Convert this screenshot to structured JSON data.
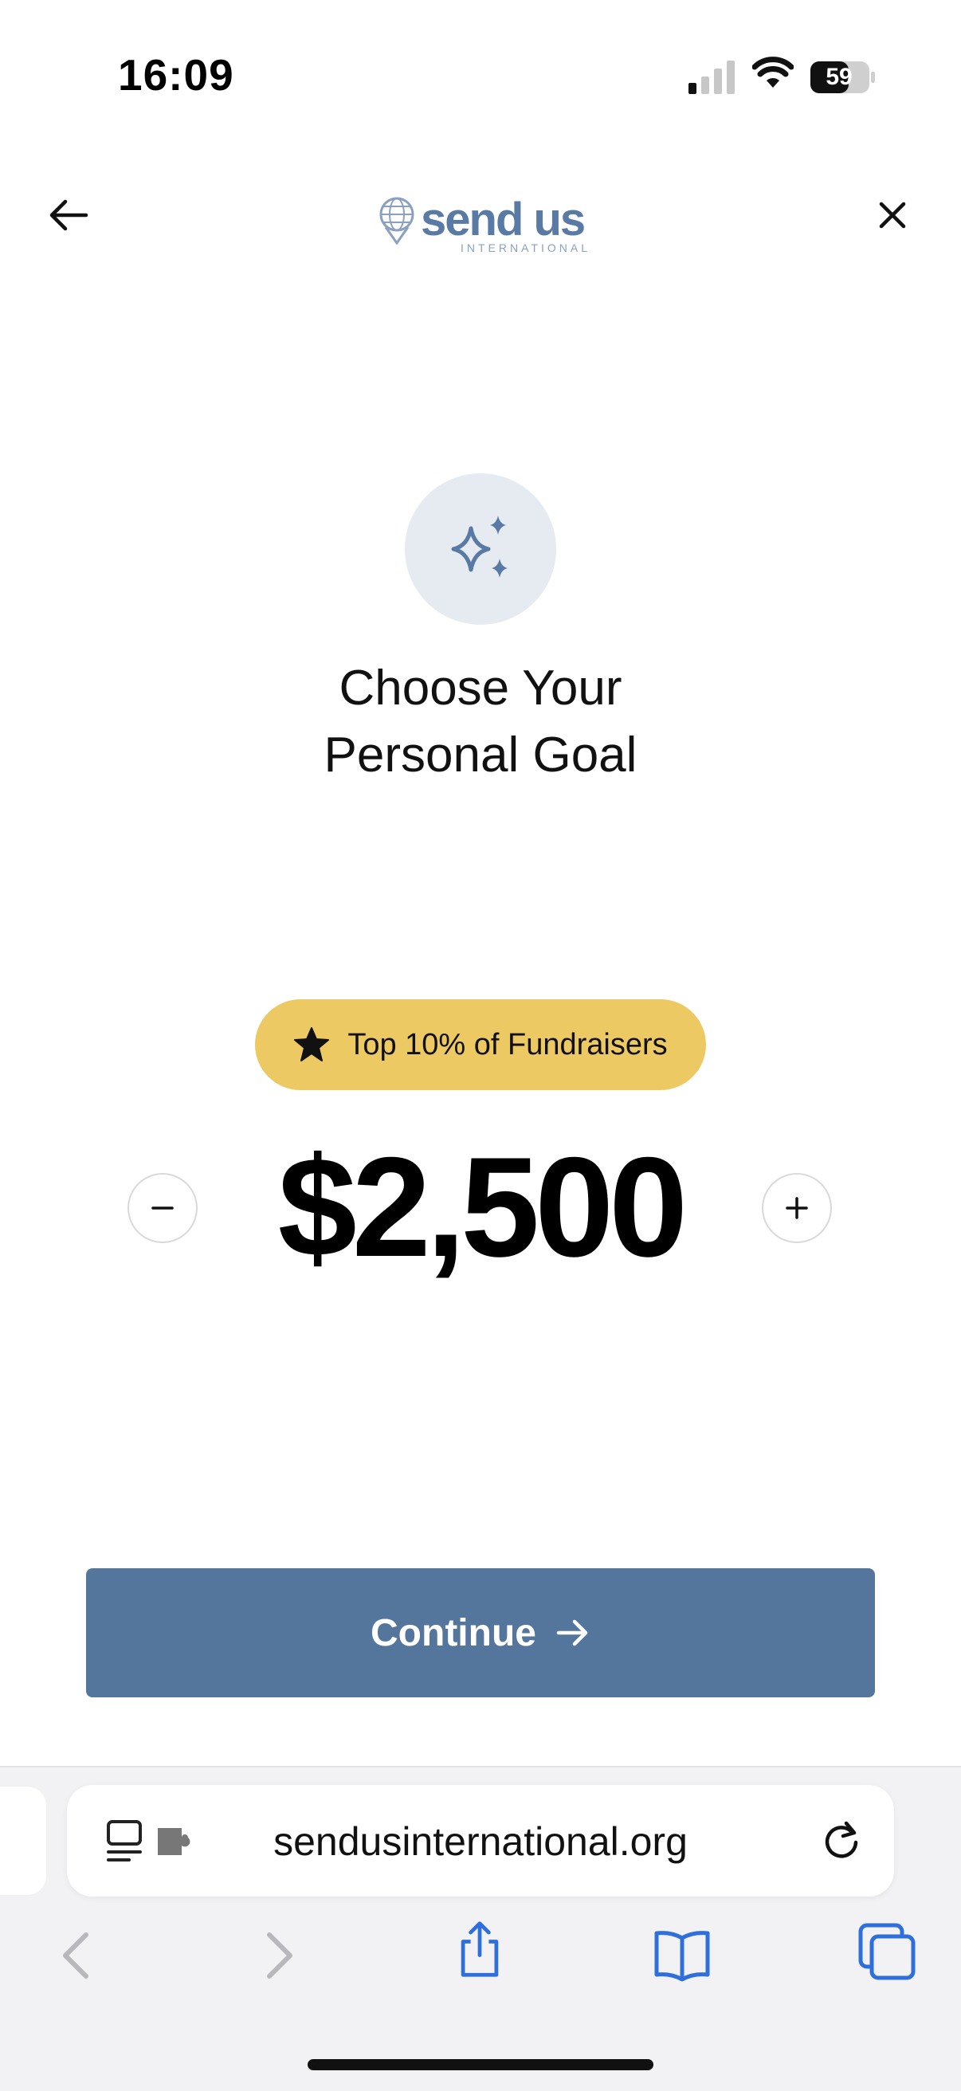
{
  "status_bar": {
    "time": "16:09",
    "battery_level": "59"
  },
  "header": {
    "logo_text": "send us",
    "logo_subtext": "INTERNATIONAL",
    "icons": [
      "back-arrow-icon",
      "close-icon",
      "globe-pin-icon"
    ]
  },
  "goal": {
    "icon": "sparkles-icon",
    "title_line1": "Choose Your",
    "title_line2": "Personal Goal",
    "badge_label": "Top 10% of Fundraisers",
    "badge_icon": "star-icon",
    "amount": "$2,500"
  },
  "actions": {
    "continue_label": "Continue"
  },
  "browser": {
    "url": "sendusinternational.org"
  },
  "colors": {
    "accent": "#54769d",
    "badge": "#ecc963",
    "icon_circle": "#e6ebf2",
    "ios_blue": "#2f6fdb"
  }
}
